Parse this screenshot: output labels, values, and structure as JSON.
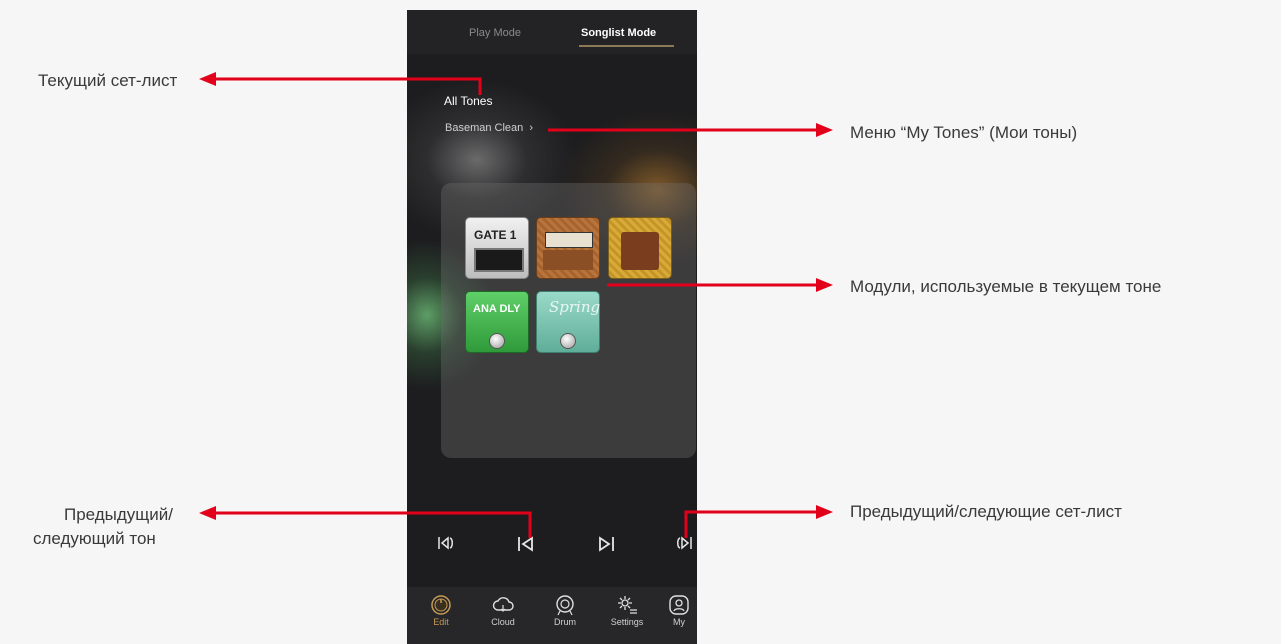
{
  "annotations": {
    "current_setlist": "Текущий сет-лист",
    "my_tones_menu": "Меню “My Tones” (Мои тоны)",
    "modules": "Модули, используемые в текущем тоне",
    "prev_next_tone_line1": "Предыдущий/",
    "prev_next_tone_line2": "следующий тон",
    "prev_next_setlist": "Предыдущий/следующие сет-лист"
  },
  "tabs": {
    "play": "Play Mode",
    "songlist": "Songlist Mode"
  },
  "setlist_name": "All Tones",
  "tone_name": "Baseman Clean",
  "modules": [
    {
      "name": "gate",
      "label": "GATE 1"
    },
    {
      "name": "amp-1",
      "label": ""
    },
    {
      "name": "cab",
      "label": ""
    },
    {
      "name": "ana-dly",
      "label": "ANA DLY"
    },
    {
      "name": "spring",
      "label": "Spring"
    }
  ],
  "transport_icons": [
    "prev-setlist-icon",
    "prev-tone-icon",
    "next-tone-icon",
    "next-setlist-icon"
  ],
  "nav": [
    {
      "label": "Edit",
      "icon": "edit-knob-icon"
    },
    {
      "label": "Cloud",
      "icon": "cloud-icon"
    },
    {
      "label": "Drum",
      "icon": "drum-icon"
    },
    {
      "label": "Settings",
      "icon": "settings-icon"
    },
    {
      "label": "My",
      "icon": "user-icon"
    }
  ],
  "colors": {
    "arrow": "#e3001b",
    "accent": "#c69a52",
    "background": "#1d1d1f"
  }
}
